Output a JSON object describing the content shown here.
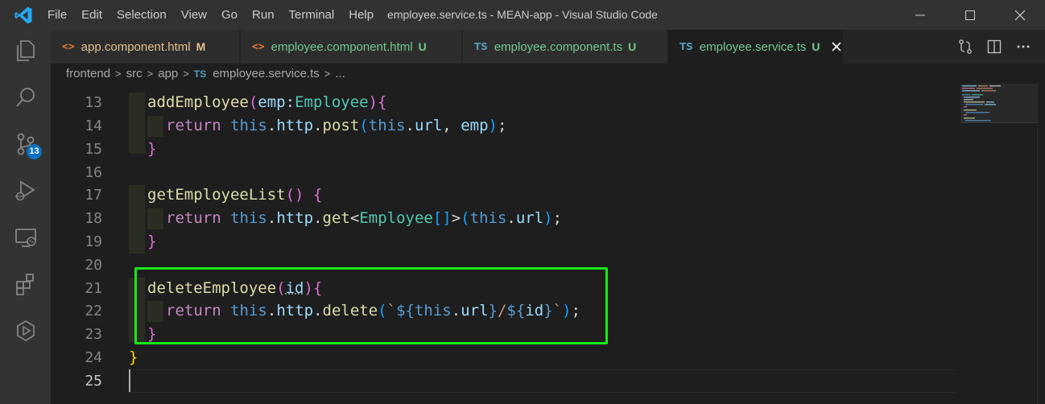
{
  "window": {
    "title": "employee.service.ts - MEAN-app - Visual Studio Code"
  },
  "menu": [
    "File",
    "Edit",
    "Selection",
    "View",
    "Go",
    "Run",
    "Terminal",
    "Help"
  ],
  "activity_bar": {
    "scm_badge": "13"
  },
  "tabs": [
    {
      "icon": "<>",
      "label": "app.component.html",
      "status": "M",
      "label_color": "#e2c08d",
      "status_color": "#e2c08d"
    },
    {
      "icon": "<>",
      "label": "employee.component.html",
      "status": "U",
      "label_color": "#73c991",
      "status_color": "#73c991"
    },
    {
      "icon": "TS",
      "label": "employee.component.ts",
      "status": "U",
      "label_color": "#73c991",
      "status_color": "#73c991"
    },
    {
      "icon": "TS",
      "label": "employee.service.ts",
      "status": "U",
      "label_color": "#73c991",
      "status_color": "#73c991",
      "active": true
    }
  ],
  "breadcrumb": {
    "parts": [
      "frontend",
      "src",
      "app"
    ],
    "file_icon": "TS",
    "file": "employee.service.ts",
    "tail": "..."
  },
  "editor": {
    "line_numbers": [
      "13",
      "14",
      "15",
      "16",
      "17",
      "18",
      "19",
      "20",
      "21",
      "22",
      "23",
      "24",
      "25"
    ],
    "lines_text": [
      "addEmployee(emp:Employee){",
      "return this.http.post(this.url, emp);",
      "}",
      "",
      "getEmployeeList() {",
      "return this.http.get<Employee[]>(this.url);",
      "}",
      "",
      "deleteEmployee(id){",
      "return this.http.delete(`${this.url}/${id}`);",
      "}",
      "}",
      ""
    ],
    "tokens": {
      "this": "this",
      "return": "return",
      "http": "http",
      "url": "url",
      "emp": "emp",
      "id": "id",
      "employee_type": "Employee",
      "fn_add": "addEmployee",
      "fn_post": "post",
      "fn_getlist": "getEmployeeList",
      "fn_get": "get",
      "fn_delete": "deleteEmployee",
      "fn_del": "delete"
    },
    "colors": {
      "keyword_this": "#569cd6",
      "keyword_return": "#c586c0",
      "function": "#dcdcaa",
      "type": "#4ec9b0",
      "variable": "#9cdcfe",
      "string": "#ce9178",
      "highlight_box": "#18e818"
    }
  }
}
